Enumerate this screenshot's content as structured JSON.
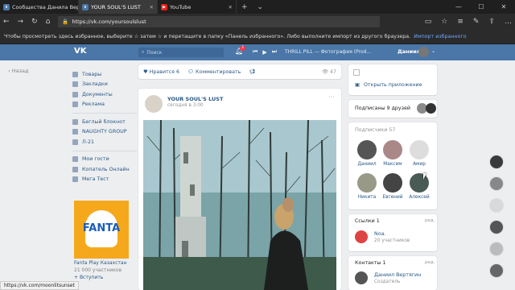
{
  "browser": {
    "tabs": [
      {
        "label": "Сообщества Данила Верт",
        "active": false
      },
      {
        "label": "YOUR SOUL'S LUST",
        "active": true
      },
      {
        "label": "YouTube",
        "active": false
      }
    ],
    "url": "https://vk.com/yoursoulslust",
    "favorites_notice": "Чтобы просмотреть здесь избранное, выберите ☆ затем ☆ и перетащите в папку «Панель избранного». Либо выполните импорт из другого браузера.",
    "favorites_link": "Импорт избранного",
    "status_url": "https://vk.com/moonlitsunset"
  },
  "vk_header": {
    "logo": "VK",
    "search_placeholder": "Поиск",
    "notif_count": "2",
    "track": "THRILL PILL — Фотография (Prod...",
    "user_name": "Даниил"
  },
  "left": {
    "back": "Назад",
    "menu1": [
      "Товары",
      "Закладки",
      "Документы",
      "Реклама"
    ],
    "menu2": [
      "Беглый блокнот",
      "NAUGHTY GROUP",
      "Л-21"
    ],
    "menu3": [
      "Мои гости",
      "Копатель Онлайн",
      "Мега Тест"
    ],
    "ad": {
      "brand": "FANTA",
      "title": "Fanta Play Казахстан",
      "subs": "21 000 участников",
      "join": "Вступить"
    }
  },
  "post_actions": {
    "like_label": "Нравится",
    "like_count": "6",
    "comment_label": "Комментировать",
    "views": "47"
  },
  "post": {
    "author": "YOUR SOUL'S LUST",
    "date": "сегодня в 3:00"
  },
  "right": {
    "open_app": "Открыть приложение",
    "friends_subscribed": "Подписаны 9 друзей",
    "subscribers_title": "Подписчики",
    "subscribers_count": "57",
    "subscribers": [
      "Даниил",
      "Максим",
      "Амир",
      "Никита",
      "Евгений",
      "Алексей"
    ],
    "links_title": "Ссылки",
    "links_count": "1",
    "edit": "ред.",
    "link_name": "Noa.",
    "link_sub": "20 участников",
    "contacts_title": "Контакты",
    "contacts_count": "1",
    "contact_name": "Даниил Вертягин",
    "contact_role": "Создатель"
  }
}
